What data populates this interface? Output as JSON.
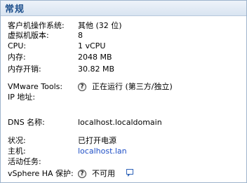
{
  "header": {
    "title": "常规"
  },
  "rows": {
    "guest_os": {
      "label": "客户机操作系统:",
      "value": "其他 (32 位)"
    },
    "vm_version": {
      "label": "虚拟机版本:",
      "value": "8"
    },
    "cpu": {
      "label": "CPU:",
      "value": "1 vCPU"
    },
    "memory": {
      "label": "内存:",
      "value": "2048 MB"
    },
    "memory_overhead": {
      "label": "内存开销:",
      "value": "30.82 MB"
    },
    "vmware_tools": {
      "label": "VMware Tools:",
      "value": "正在运行 (第三方/独立)"
    },
    "ip_address": {
      "label": "IP 地址:",
      "value": ""
    },
    "dns_name": {
      "label": "DNS 名称:",
      "value": "localhost.localdomain"
    },
    "state": {
      "label": "状况:",
      "value": "已打开电源"
    },
    "host": {
      "label": "主机:",
      "value": "localhost.lan"
    },
    "active_tasks": {
      "label": "活动任务:",
      "value": ""
    },
    "vsphere_ha": {
      "label": "vSphere HA 保护:",
      "value": "不可用"
    }
  },
  "icons": {
    "help": "help-icon",
    "comment": "comment-icon",
    "help_glyph": "?"
  },
  "colors": {
    "header_text": "#1d4f8c",
    "link": "#1f4fc6"
  }
}
